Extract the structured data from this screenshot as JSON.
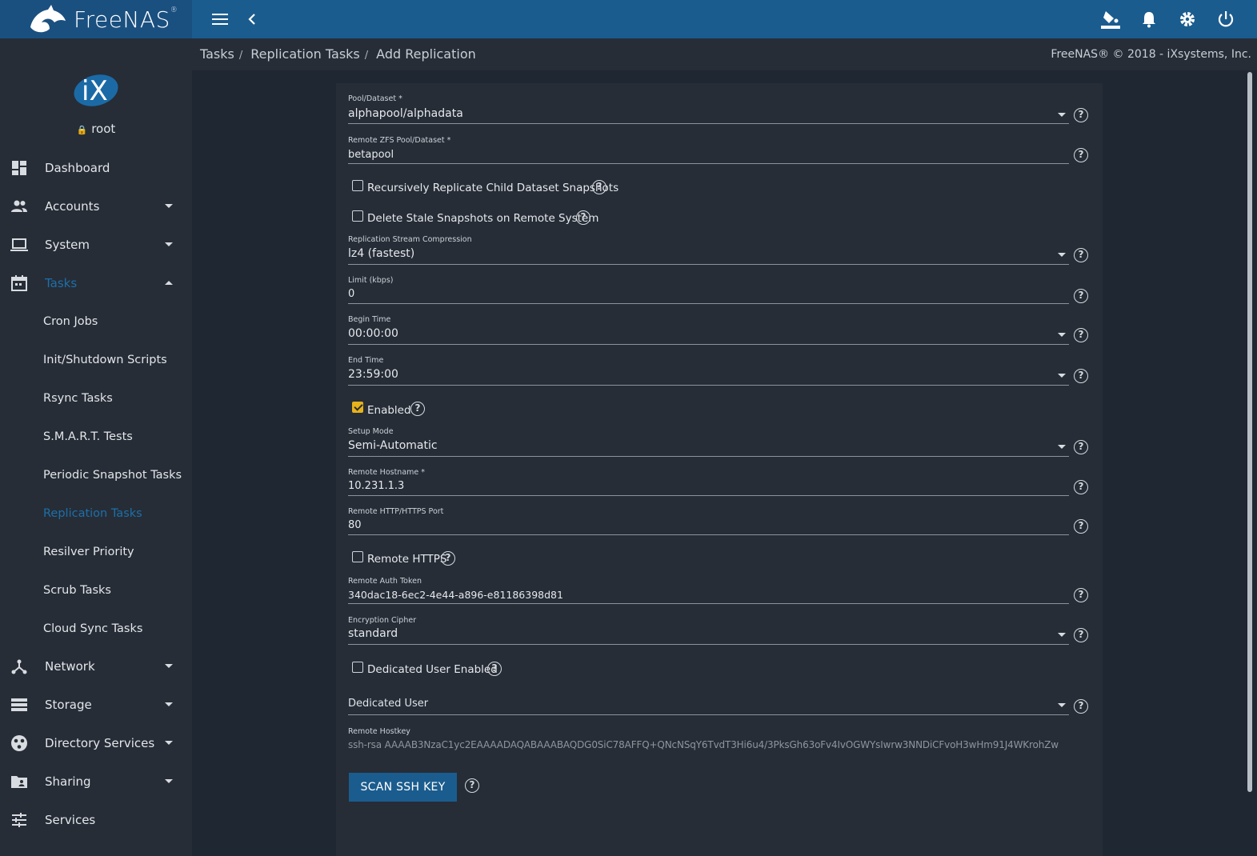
{
  "app": {
    "brand": "FreeNAS",
    "trademark": "®"
  },
  "header": {
    "menu_icon": "menu-icon",
    "back_icon": "chevron-left-icon",
    "actions": [
      "theme-icon",
      "bell-icon",
      "gear-icon",
      "power-icon"
    ]
  },
  "user": {
    "name": "root"
  },
  "sidebar": {
    "items": [
      {
        "label": "Dashboard",
        "icon": "dashboard-icon"
      },
      {
        "label": "Accounts",
        "icon": "people-icon"
      },
      {
        "label": "System",
        "icon": "laptop-icon"
      },
      {
        "label": "Tasks",
        "icon": "calendar-icon"
      },
      {
        "label": "Network",
        "icon": "network-icon"
      },
      {
        "label": "Storage",
        "icon": "storage-icon"
      },
      {
        "label": "Directory Services",
        "icon": "directory-icon"
      },
      {
        "label": "Sharing",
        "icon": "folder-shared-icon"
      },
      {
        "label": "Services",
        "icon": "tune-icon"
      }
    ],
    "tasks_sub": [
      "Cron Jobs",
      "Init/Shutdown Scripts",
      "Rsync Tasks",
      "S.M.A.R.T. Tests",
      "Periodic Snapshot Tasks",
      "Replication Tasks",
      "Resilver Priority",
      "Scrub Tasks",
      "Cloud Sync Tasks"
    ]
  },
  "breadcrumb": {
    "items": [
      "Tasks",
      "Replication Tasks",
      "Add Replication"
    ]
  },
  "copyright": "FreeNAS® © 2018 - iXsystems, Inc.",
  "form": {
    "pool_dataset": {
      "label": "Pool/Dataset  *",
      "value": "alphapool/alphadata"
    },
    "remote_dataset": {
      "label": "Remote ZFS Pool/Dataset  *",
      "value": "betapool"
    },
    "recursive": {
      "label": "Recursively Replicate Child Dataset Snapshots",
      "checked": false
    },
    "delete_stale": {
      "label": "Delete Stale Snapshots on Remote System",
      "checked": false
    },
    "compression": {
      "label": "Replication Stream Compression",
      "value": "lz4 (fastest)"
    },
    "limit": {
      "label": "Limit (kbps)",
      "value": "0"
    },
    "begin_time": {
      "label": "Begin Time",
      "value": "00:00:00"
    },
    "end_time": {
      "label": "End Time",
      "value": "23:59:00"
    },
    "enabled": {
      "label": "Enabled",
      "checked": true
    },
    "setup_mode": {
      "label": "Setup Mode",
      "value": "Semi-Automatic"
    },
    "remote_hostname": {
      "label": "Remote Hostname  *",
      "value": "10.231.1.3"
    },
    "remote_port": {
      "label": "Remote HTTP/HTTPS Port",
      "value": "80"
    },
    "remote_https": {
      "label": "Remote HTTPS",
      "checked": false
    },
    "auth_token": {
      "label": "Remote Auth Token",
      "value": "340dac18-6ec2-4e44-a896-e81186398d81"
    },
    "cipher": {
      "label": "Encryption Cipher",
      "value": "standard"
    },
    "dedicated_enabled": {
      "label": "Dedicated User Enabled",
      "checked": false
    },
    "dedicated_user": {
      "placeholder": "Dedicated User"
    },
    "hostkey": {
      "label": "Remote Hostkey",
      "value": "ssh-rsa AAAAB3NzaC1yc2EAAAADAQABAAABAQDG0SiC78AFFQ+QNcNSqY6TvdT3Hi6u4/3PksGh63oFv4IvOGWYsIwrw3NNDiCFvoH3wHm91J4WKrohZw"
    },
    "scan_button": "SCAN SSH KEY"
  },
  "colors": {
    "topbar": "#1b5c8e",
    "sidebar": "#262d37",
    "accent": "#1e6fa8",
    "checkbox_on": "#e8b219"
  }
}
